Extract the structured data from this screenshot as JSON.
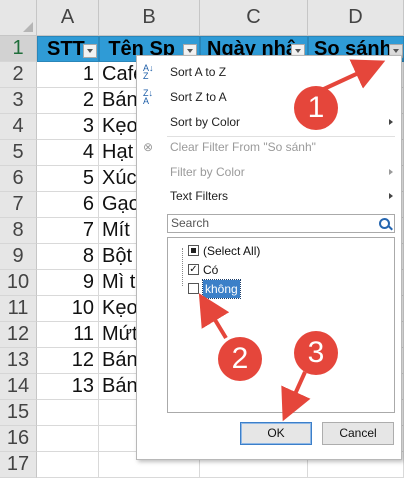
{
  "columns": [
    "A",
    "B",
    "C",
    "D"
  ],
  "row_numbers": [
    "1",
    "2",
    "3",
    "4",
    "5",
    "6",
    "7",
    "8",
    "9",
    "10",
    "11",
    "12",
    "13",
    "14",
    "15",
    "16",
    "17"
  ],
  "header_row": {
    "stt": "STT",
    "ten_sp": "Tên Sp",
    "ngay_nhap": "Ngày nhậ",
    "so_sanh": "So sánh"
  },
  "rows": [
    {
      "stt": "1",
      "ten": "Cafe"
    },
    {
      "stt": "2",
      "ten": "Bán"
    },
    {
      "stt": "3",
      "ten": "Kẹo"
    },
    {
      "stt": "4",
      "ten": "Hạt"
    },
    {
      "stt": "5",
      "ten": "Xúc"
    },
    {
      "stt": "6",
      "ten": "Gạo"
    },
    {
      "stt": "7",
      "ten": "Mít s"
    },
    {
      "stt": "8",
      "ten": "Bột"
    },
    {
      "stt": "9",
      "ten": "Mì tô"
    },
    {
      "stt": "10",
      "ten": "Kẹo"
    },
    {
      "stt": "11",
      "ten": "Mứt"
    },
    {
      "stt": "12",
      "ten": "Bán"
    },
    {
      "stt": "13",
      "ten": "Bán"
    }
  ],
  "menu": {
    "sort_az": "Sort A to Z",
    "sort_za": "Sort Z to A",
    "sort_by_color": "Sort by Color",
    "clear_filter": "Clear Filter From \"So sánh\"",
    "filter_by_color": "Filter by Color",
    "text_filters": "Text Filters",
    "search_placeholder": "Search",
    "items": {
      "select_all": "(Select All)",
      "co": "Có",
      "khong": "không"
    },
    "ok": "OK",
    "cancel": "Cancel"
  },
  "annotations": [
    "1",
    "2",
    "3"
  ],
  "colors": {
    "header_fill": "#2f9bd6",
    "badge": "#e5463b",
    "selection": "#3c80c8"
  }
}
